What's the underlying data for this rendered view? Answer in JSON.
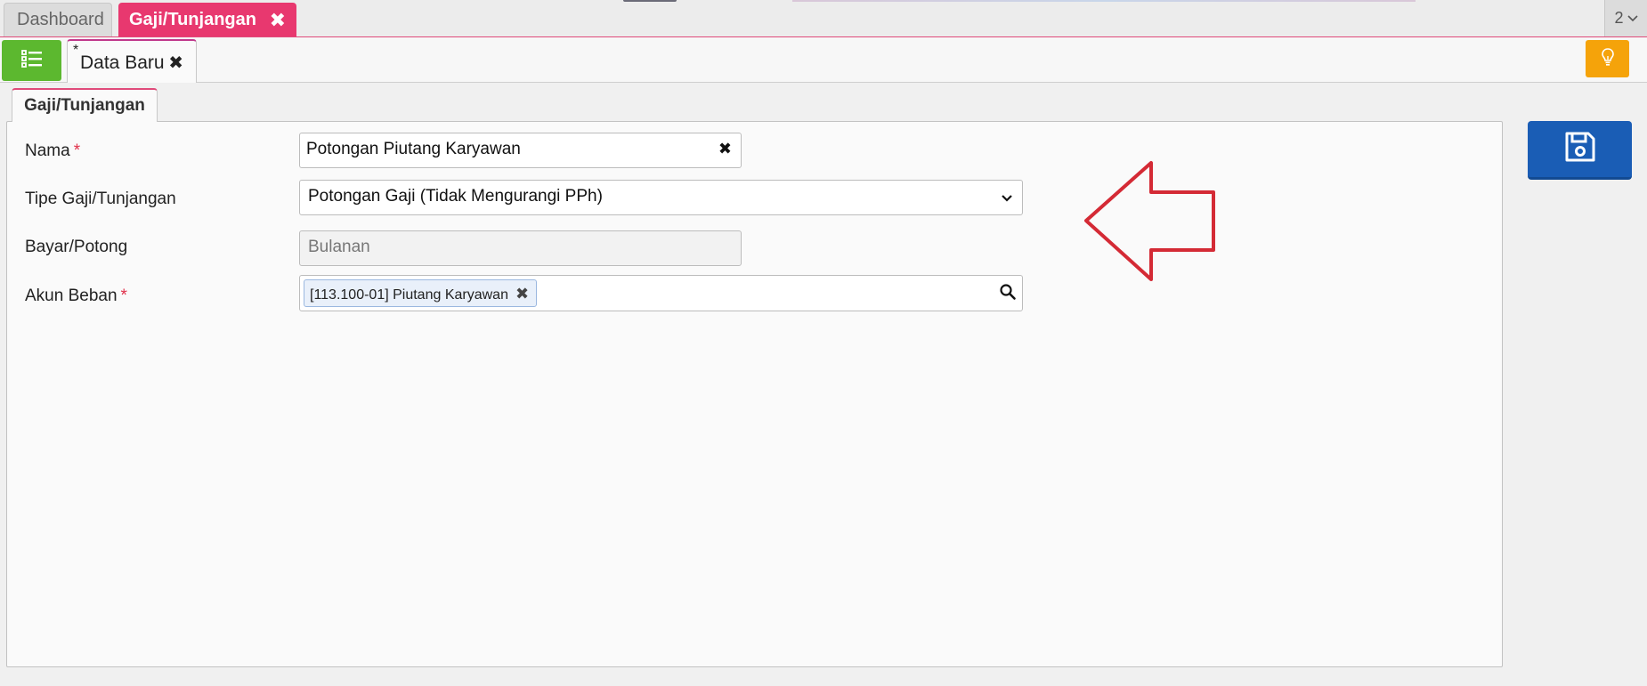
{
  "top_tabs": [
    {
      "label": "Dashboard",
      "active": false
    },
    {
      "label": "Gaji/Tunjangan",
      "active": true,
      "close": "✖"
    }
  ],
  "tab_counter": {
    "count": "2",
    "chevron": "⌄"
  },
  "subbar": {
    "list_button_icon": "list-icon",
    "doc_tab": {
      "modified_marker": "*",
      "label": "Data Baru",
      "close": "✖"
    },
    "bulb_button_icon": "lightbulb-icon"
  },
  "section_tab": {
    "label": "Gaji/Tunjangan"
  },
  "form": {
    "nama": {
      "label": "Nama",
      "required_marker": "*",
      "value": "Potongan Piutang Karyawan",
      "clear": "✖"
    },
    "tipe": {
      "label": "Tipe Gaji/Tunjangan",
      "value": "Potongan Gaji (Tidak Mengurangi PPh)"
    },
    "bayar": {
      "label": "Bayar/Potong",
      "value": "Bulanan"
    },
    "akun": {
      "label": "Akun Beban",
      "required_marker": "*",
      "tag": "[113.100-01] Piutang Karyawan",
      "tag_remove": "✖"
    }
  },
  "save_button_icon": "floppy-disk-icon",
  "colors": {
    "accent_pink": "#e8386f",
    "list_green": "#5cb82f",
    "bulb_orange": "#f5a30a",
    "save_blue": "#1a5db5",
    "annotation_red": "#d42a35"
  }
}
